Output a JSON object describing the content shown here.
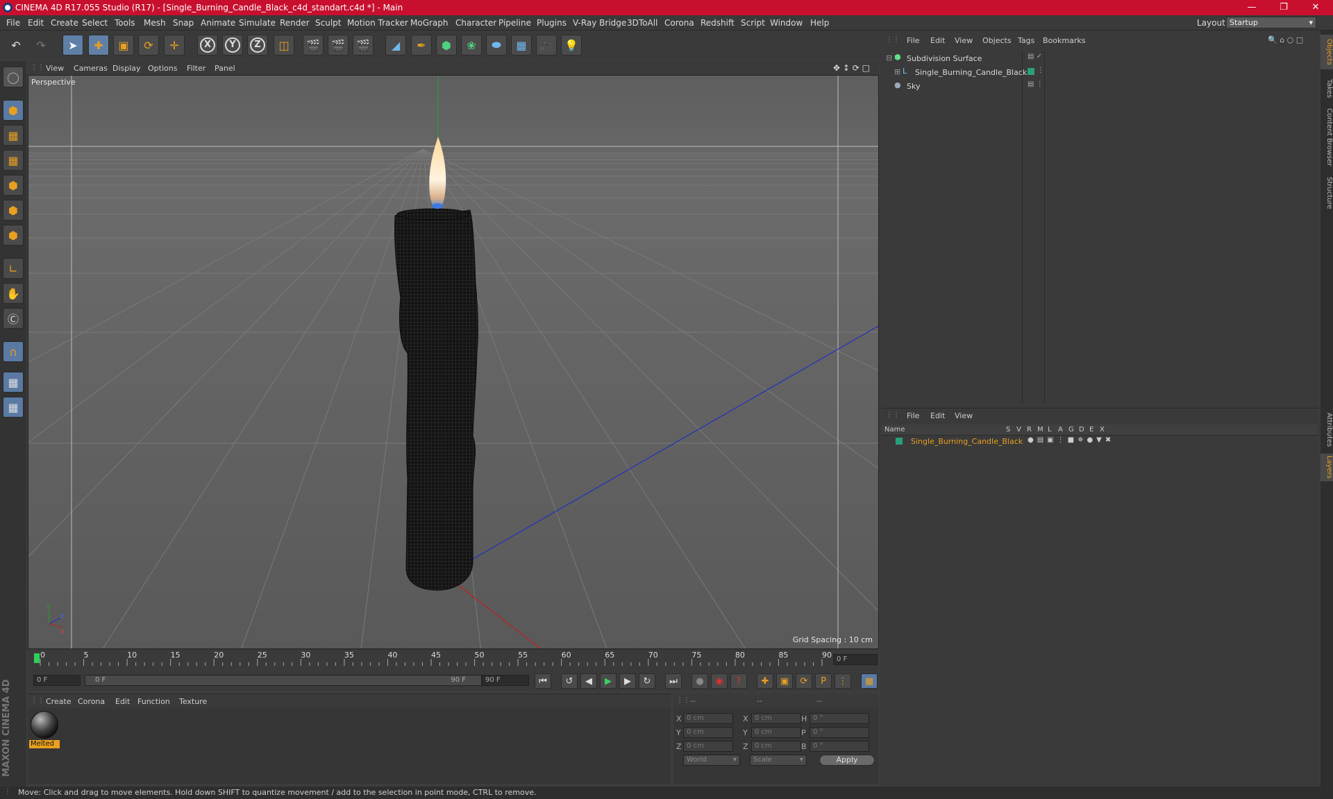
{
  "title": {
    "text": "CINEMA 4D R17.055 Studio (R17) - [Single_Burning_Candle_Black_c4d_standart.c4d *] - Main"
  },
  "menubar": {
    "items": [
      "File",
      "Edit",
      "Create",
      "Select",
      "Tools",
      "Mesh",
      "Snap",
      "Animate",
      "Simulate",
      "Render",
      "Sculpt",
      "Motion Tracker",
      "MoGraph",
      "Character",
      "Pipeline",
      "Plugins",
      "V-Ray Bridge",
      "3DToAll",
      "Corona",
      "Redshift",
      "Script",
      "Window",
      "Help"
    ],
    "layout_label": "Layout:",
    "layout_value": "Startup"
  },
  "viewport": {
    "menu": [
      "View",
      "Cameras",
      "Display",
      "Options",
      "Filter",
      "Panel"
    ],
    "label": "Perspective",
    "grid_spacing": "Grid Spacing : 10 cm"
  },
  "timeline": {
    "ticks": [
      "0",
      "5",
      "10",
      "15",
      "20",
      "25",
      "30",
      "35",
      "40",
      "45",
      "50",
      "55",
      "60",
      "65",
      "70",
      "75",
      "80",
      "85",
      "90"
    ],
    "current_frame": "0 F"
  },
  "transport": {
    "start": "0 F",
    "range_start": "0 F",
    "range_end": "90 F",
    "end": "90 F"
  },
  "materials": {
    "menu": [
      "Create",
      "Corona",
      "Edit",
      "Function",
      "Texture"
    ],
    "items": [
      {
        "name": "Melted"
      }
    ]
  },
  "coords": {
    "header": [
      "--",
      "--",
      "--"
    ],
    "rows": [
      {
        "a": "X",
        "av": "0 cm",
        "b": "X",
        "bv": "0 cm",
        "c": "H",
        "cv": "0 °"
      },
      {
        "a": "Y",
        "av": "0 cm",
        "b": "Y",
        "bv": "0 cm",
        "c": "P",
        "cv": "0 °"
      },
      {
        "a": "Z",
        "av": "0 cm",
        "b": "Z",
        "bv": "0 cm",
        "c": "B",
        "cv": "0 °"
      }
    ],
    "mode": "World",
    "scale": "Scale",
    "apply": "Apply"
  },
  "objects": {
    "menu": [
      "File",
      "Edit",
      "View",
      "Objects",
      "Tags",
      "Bookmarks"
    ],
    "items": [
      {
        "name": "Subdivision Surface",
        "color": "#5fb4e0"
      },
      {
        "name": "Single_Burning_Candle_Black",
        "color": "#d8d8d8"
      },
      {
        "name": "Sky",
        "color": "#d8d8d8"
      }
    ]
  },
  "layers": {
    "menu": [
      "File",
      "Edit",
      "View"
    ],
    "columns": [
      "Name",
      "S",
      "V",
      "R",
      "M",
      "L",
      "A",
      "G",
      "D",
      "E",
      "X"
    ],
    "items": [
      {
        "name": "Single_Burning_Candle_Black",
        "color": "#e8a020"
      }
    ]
  },
  "sidetabs": [
    "Objects",
    "Takes",
    "Content Browser",
    "Structure",
    "Attributes",
    "Layers"
  ],
  "status": {
    "text": "Move: Click and drag to move elements. Hold down SHIFT to quantize movement / add to the selection in point mode, CTRL to remove."
  },
  "brand": {
    "text": "MAXON CINEMA 4D"
  }
}
